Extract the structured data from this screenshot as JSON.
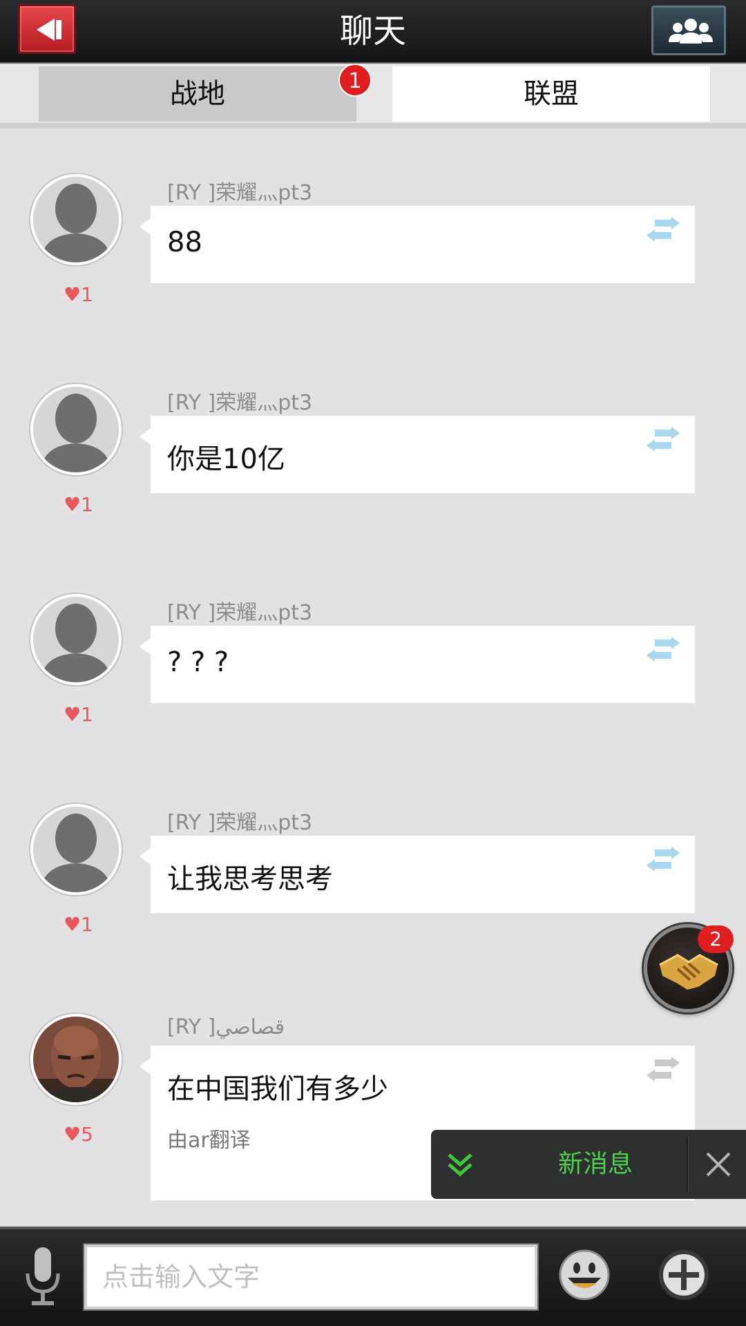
{
  "header": {
    "title": "聊天",
    "back_icon": "back-arrow-icon",
    "group_icon": "group-members-icon",
    "accent": "#d7262d"
  },
  "tabs": {
    "items": [
      {
        "label": "战地",
        "badge": "1"
      },
      {
        "label": "联盟"
      }
    ]
  },
  "messages": [
    {
      "sender": "[RY ]荣耀灬pt3",
      "text": "88",
      "likes": "1",
      "avatar": "default-silhouette"
    },
    {
      "sender": "[RY ]荣耀灬pt3",
      "text": "你是10亿",
      "likes": "1",
      "avatar": "default-silhouette"
    },
    {
      "sender": "[RY ]荣耀灬pt3",
      "text": "? ? ?",
      "likes": "1",
      "avatar": "default-silhouette"
    },
    {
      "sender": "[RY ]荣耀灬pt3",
      "text": "让我思考思考",
      "likes": "1",
      "avatar": "default-silhouette"
    },
    {
      "sender": "[RY ]قصاصي",
      "text": "在中国我们有多少",
      "likes": "5",
      "avatar": "soldier-portrait",
      "translated_note": "由ar翻译"
    }
  ],
  "floating": {
    "icon": "handshake-icon",
    "badge": "2"
  },
  "toast": {
    "label": "新消息",
    "icon": "double-chevron-down-icon",
    "close_icon": "close-icon",
    "color": "#4fd04f"
  },
  "input_bar": {
    "placeholder": "点击输入文字",
    "mic_icon": "microphone-icon",
    "emoji_icon": "smiley-icon",
    "plus_icon": "plus-circle-icon"
  }
}
